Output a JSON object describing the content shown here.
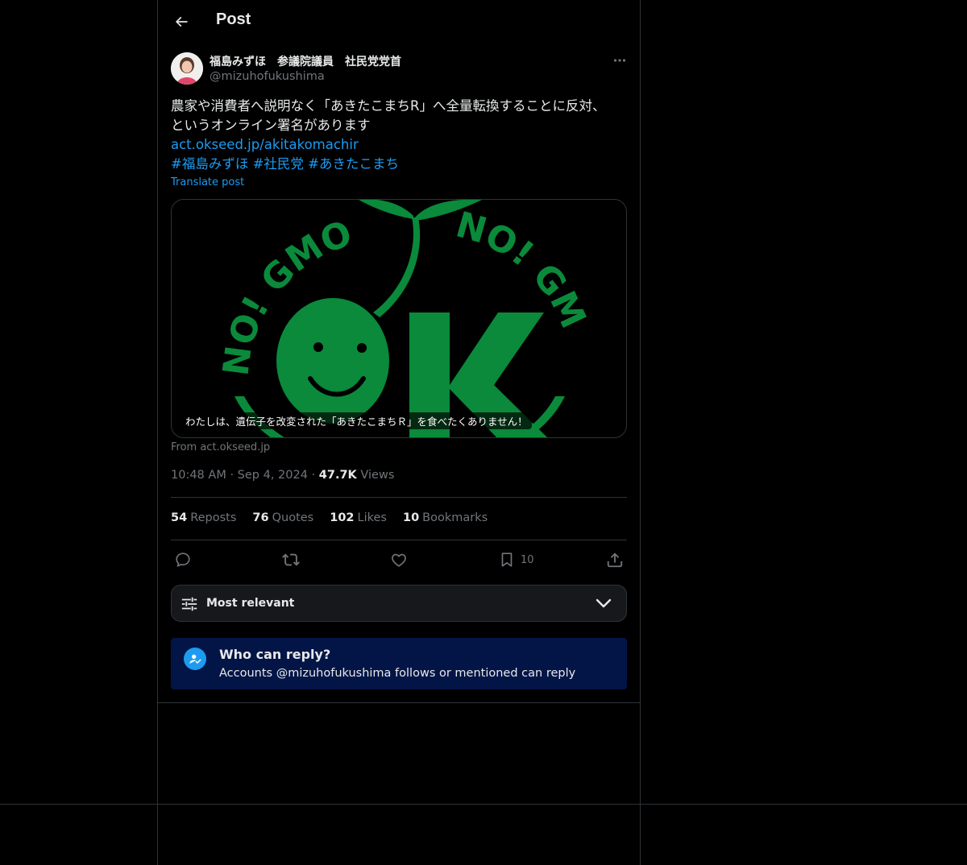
{
  "header": {
    "back_icon": "arrow-left-icon",
    "title": "Post"
  },
  "author": {
    "display_name": "福島みずほ　参議院議員　社民党党首",
    "handle": "@mizuhofukushima",
    "more_icon": "more-horizontal-icon"
  },
  "post": {
    "text_lines": [
      "農家や消費者へ説明なく「あきたこまちR」へ全量転換することに反対、",
      "というオンライン署名があります"
    ],
    "link": "act.okseed.jp/akitakomachir",
    "hashtags": [
      "#福島みずほ",
      "#社民党",
      "#あきたこまち"
    ],
    "translate_label": "Translate post"
  },
  "card": {
    "logo_left_text": "NO! GMO",
    "logo_right_text": "NO! GM",
    "logo_center_text": "OK",
    "caption": "わたしは、遺伝子を改変された「あきたこまちＲ」を食べたくありません！",
    "source": "From act.okseed.jp",
    "brand_color": "#0a8a3a"
  },
  "meta": {
    "time": "10:48 AM",
    "date": "Sep 4, 2024",
    "views_count": "47.7K",
    "views_label": "Views"
  },
  "stats": {
    "reposts": {
      "count": "54",
      "label": "Reposts"
    },
    "quotes": {
      "count": "76",
      "label": "Quotes"
    },
    "likes": {
      "count": "102",
      "label": "Likes"
    },
    "bookmarks": {
      "count": "10",
      "label": "Bookmarks"
    }
  },
  "actions": {
    "reply_icon": "reply-icon",
    "repost_icon": "repost-icon",
    "like_icon": "heart-icon",
    "bookmark_icon": "bookmark-icon",
    "bookmark_count": "10",
    "share_icon": "share-icon"
  },
  "sort": {
    "label": "Most relevant",
    "icon": "sliders-icon",
    "chevron": "chevron-down-icon"
  },
  "reply_restriction": {
    "title": "Who can reply?",
    "description": "Accounts @mizuhofukushima follows or mentioned can reply",
    "icon": "user-check-icon"
  },
  "colors": {
    "background": "#000000",
    "accent": "#1d9bf0",
    "text": "#e7e9ea",
    "muted": "#71767b",
    "border": "#2f3336",
    "reply_box_bg": "#031546"
  }
}
